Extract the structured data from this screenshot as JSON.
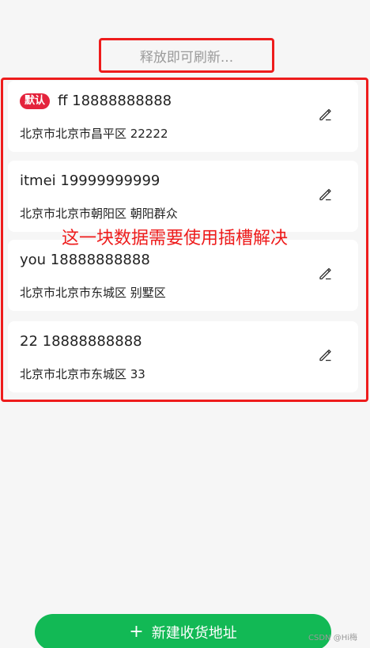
{
  "refresh": {
    "label": "释放即可刷新..."
  },
  "annotation": {
    "text": "这一块数据需要使用插槽解决"
  },
  "addresses": [
    {
      "default_badge": "默认",
      "name_phone": "ff 18888888888",
      "address": "北京市北京市昌平区 22222"
    },
    {
      "name_phone": "itmei 19999999999",
      "address": "北京市北京市朝阳区 朝阳群众"
    },
    {
      "name_phone": "you 18888888888",
      "address": "北京市北京市东城区 别墅区"
    },
    {
      "name_phone": "22 18888888888",
      "address": "北京市北京市东城区 33"
    }
  ],
  "footer": {
    "add_icon": "+",
    "add_label": "新建收货地址"
  },
  "watermark": "CSDN @Hi梅",
  "icons": {
    "edit": "pencil-icon"
  },
  "colors": {
    "accent_green": "#12b955",
    "badge_red": "#e4233c",
    "annotation_red": "#ee1c1c"
  }
}
